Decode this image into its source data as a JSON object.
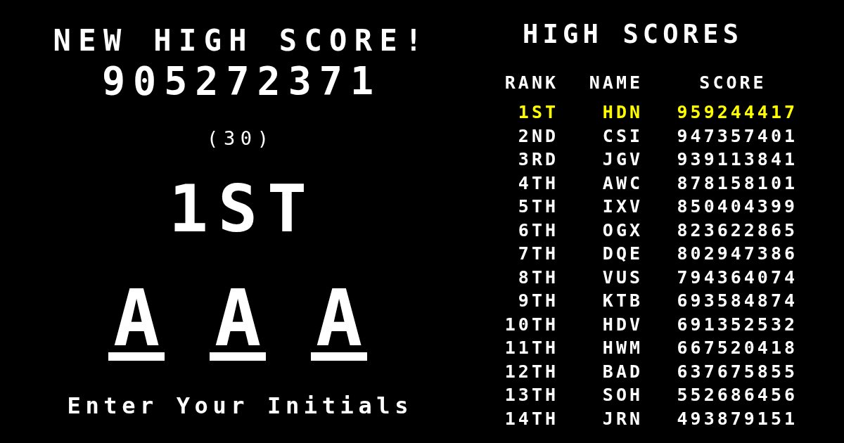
{
  "banner": {
    "title": "NEW HIGH SCORE!",
    "score": "905272371",
    "countdown": "(30)",
    "place": "1ST"
  },
  "initials": [
    {
      "letter": "A"
    },
    {
      "letter": "A"
    },
    {
      "letter": "A"
    }
  ],
  "prompt": "Enter Your Initials",
  "high_scores": {
    "title": "HIGH SCORES",
    "columns": [
      "RANK",
      "NAME",
      "SCORE"
    ],
    "rows": [
      {
        "rank": "1ST",
        "name": "HDN",
        "score": "959244417",
        "highlighted": true
      },
      {
        "rank": "2ND",
        "name": "CSI",
        "score": "947357401",
        "highlighted": false
      },
      {
        "rank": "3RD",
        "name": "JGV",
        "score": "939113841",
        "highlighted": false
      },
      {
        "rank": "4TH",
        "name": "AWC",
        "score": "878158101",
        "highlighted": false
      },
      {
        "rank": "5TH",
        "name": "IXV",
        "score": "850404399",
        "highlighted": false
      },
      {
        "rank": "6TH",
        "name": "OGX",
        "score": "823622865",
        "highlighted": false
      },
      {
        "rank": "7TH",
        "name": "DQE",
        "score": "802947386",
        "highlighted": false
      },
      {
        "rank": "8TH",
        "name": "VUS",
        "score": "794364074",
        "highlighted": false
      },
      {
        "rank": "9TH",
        "name": "KTB",
        "score": "693584874",
        "highlighted": false
      },
      {
        "rank": "10TH",
        "name": "HDV",
        "score": "691352532",
        "highlighted": false
      },
      {
        "rank": "11TH",
        "name": "HWM",
        "score": "667520418",
        "highlighted": false
      },
      {
        "rank": "12TH",
        "name": "BAD",
        "score": "637675855",
        "highlighted": false
      },
      {
        "rank": "13TH",
        "name": "SOH",
        "score": "552686456",
        "highlighted": false
      },
      {
        "rank": "14TH",
        "name": "JRN",
        "score": "493879151",
        "highlighted": false
      }
    ]
  }
}
